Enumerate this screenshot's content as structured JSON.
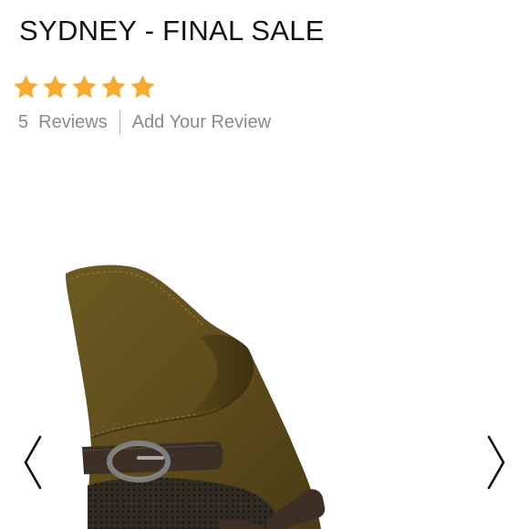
{
  "product": {
    "title": "SYDNEY - FINAL SALE"
  },
  "rating": {
    "value": 5,
    "max": 5,
    "star_color": "#F5AC31"
  },
  "reviews": {
    "count": "5",
    "label": "Reviews",
    "add_review_label": "Add Your Review"
  },
  "gallery": {
    "prev_icon": "chevron-left-icon",
    "next_icon": "chevron-right-icon",
    "image_subject": "olive suede ankle boot with buckle strap"
  }
}
